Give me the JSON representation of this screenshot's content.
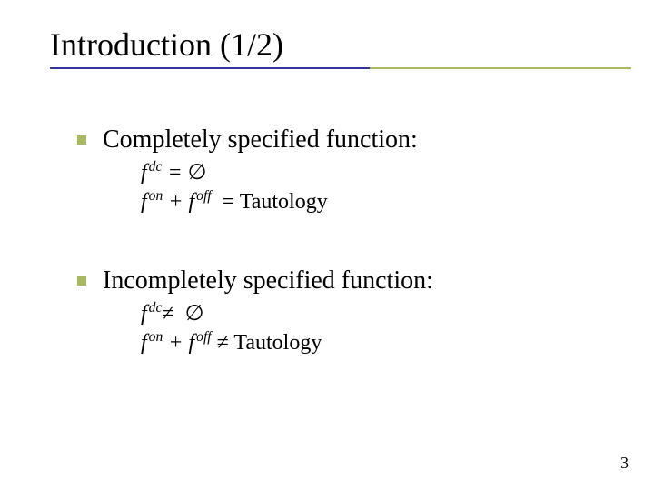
{
  "title": "Introduction (1/2)",
  "section1": {
    "heading": "Completely specified function:",
    "line1": {
      "f": "f",
      "sup1": "dc",
      "rel": "=",
      "sym": "∅"
    },
    "line2": {
      "f1": "f",
      "sup1": "on",
      "plus": "+",
      "f2": "f",
      "sup2": "off",
      "rel": "=",
      "rhs": "Tautology"
    }
  },
  "section2": {
    "heading": "Incompletely specified function:",
    "line1": {
      "f": "f",
      "sup1": "dc",
      "rel": "≠",
      "sym": "∅"
    },
    "line2": {
      "f1": "f",
      "sup1": "on",
      "plus": "+",
      "f2": "f",
      "sup2": "off",
      "rel": "≠",
      "rhs": "Tautology"
    }
  },
  "page_number": "3"
}
